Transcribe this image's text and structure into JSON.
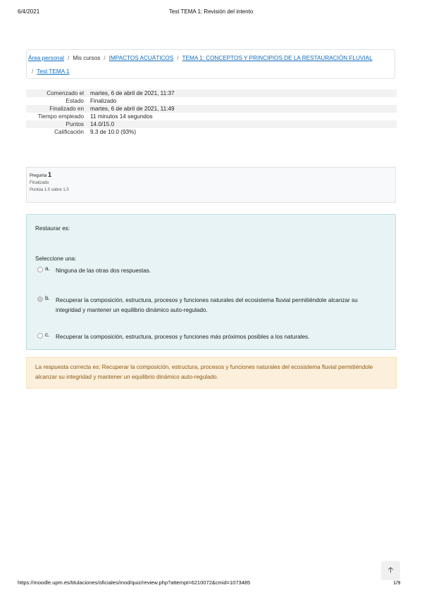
{
  "print_header": {
    "date": "6/4/2021",
    "title": "Test TEMA 1: Revisión del intento"
  },
  "breadcrumb": [
    {
      "label": "Área personal",
      "link": true
    },
    {
      "label": "Mis cursos",
      "link": false
    },
    {
      "label": "IMPACTOS ACUÁTICOS",
      "link": true
    },
    {
      "label": "TEMA 1: CONCEPTOS Y PRINCIPIOS DE LA RESTAURACIÓN FLUVIAL",
      "link": true
    },
    {
      "label": "Test TEMA 1",
      "link": true
    }
  ],
  "summary": [
    {
      "key": "Comenzado el",
      "value": "martes, 6 de abril de 2021, 11:37"
    },
    {
      "key": "Estado",
      "value": "Finalizado"
    },
    {
      "key": "Finalizado en",
      "value": "martes, 6 de abril de 2021, 11:49"
    },
    {
      "key": "Tiempo empleado",
      "value": "11 minutos 14 segundos"
    },
    {
      "key": "Puntos",
      "value": "14.0/15.0"
    },
    {
      "key": "Calificación",
      "value": "9.3 de 10.0 (93%)"
    }
  ],
  "question_info": {
    "label": "Pregunta",
    "number": "1",
    "state": "Finalizado",
    "score": "Puntúa 1.0 sobre 1.0"
  },
  "question": {
    "text": "Restaurar es:",
    "prompt": "Seleccione una:",
    "options": [
      {
        "letter": "a.",
        "text": "Ninguna de las otras dos respuestas.",
        "checked": false
      },
      {
        "letter": "b.",
        "text": "Recuperar la composición, estructura, procesos y funciones naturales del ecosistema fluvial permitiéndole alcanzar su integridad y mantener un equilibrio dinámico auto-regulado.",
        "checked": true
      },
      {
        "letter": "c.",
        "text": "Recuperar la composición, estructura, procesos y funciones más próximos posibles a los naturales.",
        "checked": false
      }
    ]
  },
  "feedback": "La respuesta correcta es: Recuperar la composición, estructura, procesos y funciones naturales del ecosistema fluvial permitiéndole alcanzar su integridad y mantener un equilibrio dinámico auto-regulado.",
  "back_to_top": {
    "icon": "arrow-up-icon"
  },
  "print_footer": {
    "url": "https://moodle.upm.es/titulaciones/oficiales/mod/quiz/review.php?attempt=6210072&cmid=1073485",
    "page": "1/9"
  }
}
